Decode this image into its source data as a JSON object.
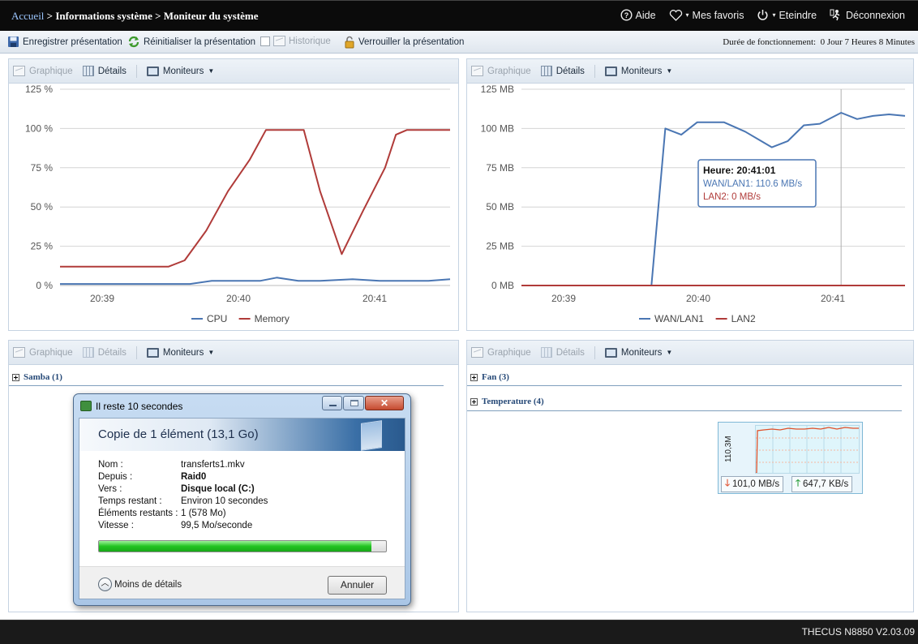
{
  "breadcrumb": {
    "home": "Accueil",
    "sep": " > ",
    "level1": "Informations système",
    "level2": "Moniteur du système"
  },
  "topnav": [
    {
      "icon": "help-icon",
      "label": "Aide"
    },
    {
      "icon": "heart-icon",
      "label": "Mes favoris"
    },
    {
      "icon": "power-icon",
      "label": "Eteindre"
    },
    {
      "icon": "logout-icon",
      "label": "Déconnexion"
    }
  ],
  "toolbar": {
    "save": "Enregistrer présentation",
    "reset": "Réinitialiser la présentation",
    "history": "Historique",
    "lock": "Verrouiller la présentation",
    "uptime_label": "Durée de fonctionnement:",
    "uptime_value": "0 Jour 7 Heures 8 Minutes"
  },
  "panel_tabs": {
    "graph": "Graphique",
    "details": "Détails",
    "monitors": "Moniteurs"
  },
  "colors": {
    "series_blue": "#4a76b3",
    "series_red": "#b03b39",
    "grid": "#d4d4d4"
  },
  "chart_data": [
    {
      "type": "line",
      "x_ticks": [
        "20:39",
        "20:40",
        "20:41"
      ],
      "y_ticks": [
        "125 %",
        "100 %",
        "75 %",
        "50 %",
        "25 %",
        "0 %"
      ],
      "ylim": [
        0,
        125
      ],
      "xlim": [
        0,
        360
      ],
      "grid": true,
      "legend_position": "bottom",
      "series": [
        {
          "name": "CPU",
          "color": "#4a76b3",
          "x": [
            0,
            60,
            100,
            120,
            140,
            165,
            185,
            200,
            220,
            240,
            270,
            295,
            320,
            340,
            360
          ],
          "y": [
            1,
            1,
            1,
            1,
            3,
            3,
            3,
            5,
            3,
            3,
            4,
            3,
            3,
            3,
            4
          ]
        },
        {
          "name": "Memory",
          "color": "#b03b39",
          "x": [
            0,
            60,
            100,
            115,
            135,
            155,
            175,
            190,
            215,
            225,
            240,
            260,
            280,
            300,
            310,
            320,
            340,
            360
          ],
          "y": [
            12,
            12,
            12,
            16,
            35,
            60,
            80,
            99,
            99,
            99,
            60,
            20,
            48,
            75,
            96,
            99,
            99,
            99
          ]
        }
      ]
    },
    {
      "type": "line",
      "x_ticks": [
        "20:39",
        "20:40",
        "20:41"
      ],
      "y_ticks": [
        "125 MB",
        "100 MB",
        "75 MB",
        "50 MB",
        "25 MB",
        "0 MB"
      ],
      "ylim": [
        0,
        125
      ],
      "xlim": [
        0,
        360
      ],
      "grid": true,
      "legend_position": "bottom",
      "series": [
        {
          "name": "WAN/LAN1",
          "color": "#4a76b3",
          "x": [
            0,
            100,
            115,
            122,
            135,
            150,
            165,
            190,
            210,
            225,
            235,
            250,
            265,
            280,
            300,
            315,
            330,
            345,
            360
          ],
          "y": [
            0,
            0,
            0,
            0,
            100,
            96,
            104,
            104,
            98,
            92,
            88,
            92,
            102,
            103,
            110,
            106,
            108,
            109,
            108
          ]
        },
        {
          "name": "LAN2",
          "color": "#b03b39",
          "x": [
            0,
            360
          ],
          "y": [
            0,
            0
          ]
        }
      ],
      "tooltip": {
        "title": "Heure: 20:41:01",
        "line1": "WAN/LAN1: 110.6 MB/s",
        "line2": "LAN2: 0 MB/s"
      }
    }
  ],
  "sections": {
    "samba": "Samba (1)",
    "fan": "Fan (3)",
    "temperature": "Temperature (4)"
  },
  "dialog": {
    "title": "Il reste 10 secondes",
    "heading": "Copie de 1 élément (13,1 Go)",
    "rows": [
      {
        "k": "Nom :",
        "v": "transferts1.mkv"
      },
      {
        "k": "Depuis :",
        "v": "Raid0"
      },
      {
        "k": "Vers :",
        "v": "Disque local (C:)"
      },
      {
        "k": "Temps restant :",
        "v": "Environ 10 secondes"
      },
      {
        "k": "Éléments restants :",
        "v": "1 (578 Mo)"
      },
      {
        "k": "Vitesse :",
        "v": "99,5 Mo/seconde"
      }
    ],
    "progress": 0.95,
    "less": "Moins de détails",
    "cancel": "Annuler"
  },
  "mini_graph": {
    "ylabel": "110,3M",
    "down": "101,0 MB/s",
    "up": "647,7 KB/s"
  },
  "version": "THECUS N8850 V2.03.09"
}
